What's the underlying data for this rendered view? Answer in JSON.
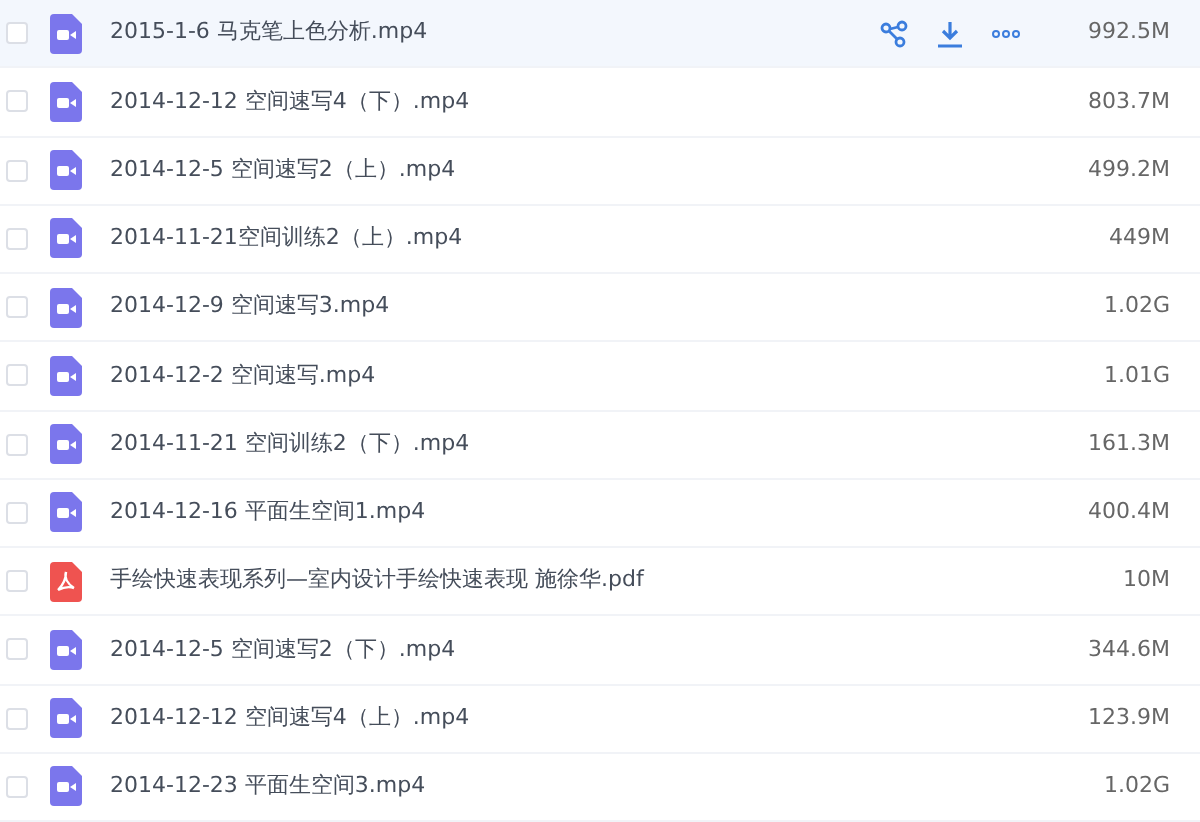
{
  "files": [
    {
      "kind": "video",
      "name": "2015-1-6 马克笔上色分析.mp4",
      "size": "992.5M",
      "checked": false,
      "highlighted": true
    },
    {
      "kind": "video",
      "name": "2014-12-12 空间速写4（下）.mp4",
      "size": "803.7M",
      "checked": false,
      "highlighted": false
    },
    {
      "kind": "video",
      "name": "2014-12-5 空间速写2（上）.mp4",
      "size": "499.2M",
      "checked": false,
      "highlighted": false
    },
    {
      "kind": "video",
      "name": "2014-11-21空间训练2（上）.mp4",
      "size": "449M",
      "checked": false,
      "highlighted": false
    },
    {
      "kind": "video",
      "name": "2014-12-9 空间速写3.mp4",
      "size": "1.02G",
      "checked": false,
      "highlighted": false
    },
    {
      "kind": "video",
      "name": "2014-12-2 空间速写.mp4",
      "size": "1.01G",
      "checked": false,
      "highlighted": false
    },
    {
      "kind": "video",
      "name": "2014-11-21 空间训练2（下）.mp4",
      "size": "161.3M",
      "checked": false,
      "highlighted": false
    },
    {
      "kind": "video",
      "name": "2014-12-16 平面生空间1.mp4",
      "size": "400.4M",
      "checked": false,
      "highlighted": false
    },
    {
      "kind": "pdf",
      "name": "手绘快速表现系列—室内设计手绘快速表现 施徐华.pdf",
      "size": "10M",
      "checked": false,
      "highlighted": false
    },
    {
      "kind": "video",
      "name": "2014-12-5 空间速写2（下）.mp4",
      "size": "344.6M",
      "checked": false,
      "highlighted": false
    },
    {
      "kind": "video",
      "name": "2014-12-12 空间速写4（上）.mp4",
      "size": "123.9M",
      "checked": false,
      "highlighted": false
    },
    {
      "kind": "video",
      "name": "2014-12-23 平面生空间3.mp4",
      "size": "1.02G",
      "checked": false,
      "highlighted": false
    }
  ]
}
